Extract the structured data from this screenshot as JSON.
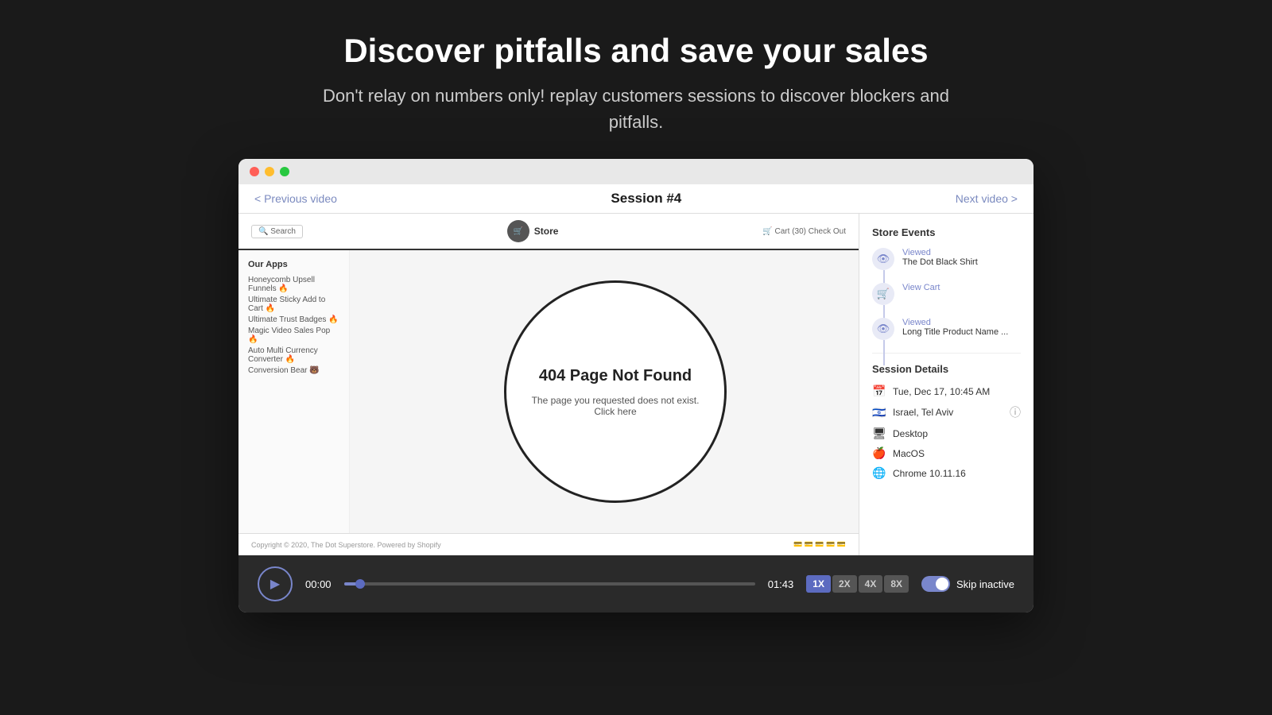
{
  "header": {
    "title": "Discover pitfalls and save your sales",
    "subtitle": "Don't relay on numbers only! replay customers sessions to discover blockers and pitfalls."
  },
  "browser": {
    "titlebar": {
      "dots": [
        "red",
        "yellow",
        "green"
      ]
    },
    "nav": {
      "prev_label": "< Previous video",
      "session_label": "Session #4",
      "next_label": "Next video >"
    }
  },
  "store": {
    "search_placeholder": "Search",
    "logo_text": "Store",
    "cart_nav": "🛒 Cart (30)   Check Out",
    "page_title": "404 Page Not Found",
    "page_sub": "The page you requested does not exist. Click here",
    "sidebar": {
      "title": "Our Apps",
      "apps": [
        "Honeycomb Upsell Funnels 🔥",
        "Ultimate Sticky Add to Cart 🔥",
        "Ultimate Trust Badges 🔥",
        "Magic Video Sales Pop 🔥",
        "Auto Multi Currency Converter 🔥",
        "Conversion Bear 🐻"
      ]
    },
    "footer": {
      "copyright": "Copyright © 2020, The Dot Superstore. Powered by Shopify",
      "payment_icons": "💳 💳 💳 💳 💳 💳"
    }
  },
  "side_panel": {
    "events_title": "Store Events",
    "events": [
      {
        "type": "view",
        "label": "Viewed",
        "name": "The Dot Black Shirt"
      },
      {
        "type": "cart",
        "label": "View Cart",
        "name": ""
      },
      {
        "type": "view",
        "label": "Viewed",
        "name": "Long Title Product Name ..."
      }
    ],
    "details_title": "Session Details",
    "datetime": "Tue, Dec 17, 10:45 AM",
    "location": "Israel, Tel Aviv",
    "device": "Desktop",
    "os": "MacOS",
    "browser": "Chrome 10.11.16"
  },
  "player": {
    "play_icon": "▶",
    "time_start": "00:00",
    "time_end": "01:43",
    "speeds": [
      "1X",
      "2X",
      "4X",
      "8X"
    ],
    "active_speed": "1X",
    "skip_inactive_label": "Skip inactive",
    "progress_percent": 4
  }
}
